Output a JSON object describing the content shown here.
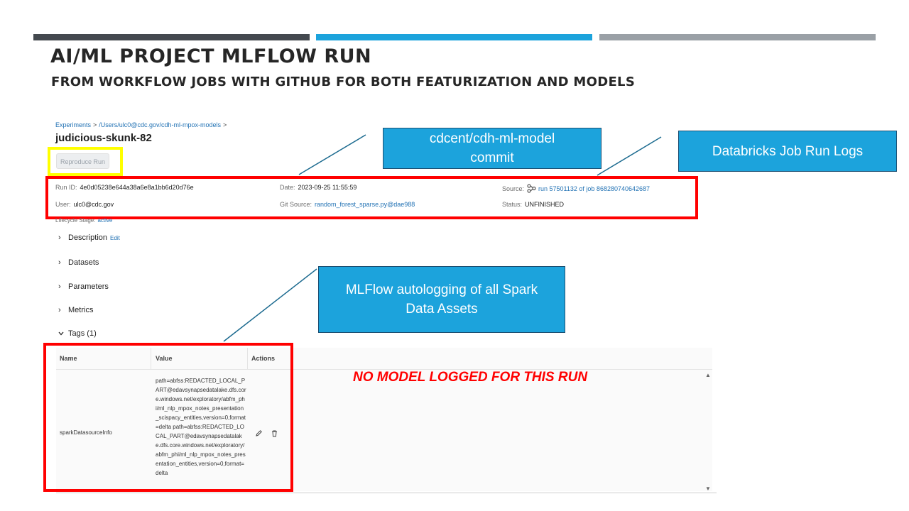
{
  "slide": {
    "title": "AI/ML PROJECT MLFLOW RUN",
    "subtitle": "FROM WORKFLOW JOBS WITH GITHUB FOR BOTH FEATURIZATION AND MODELS"
  },
  "breadcrumb": {
    "items": [
      "Experiments",
      "/Users/ulc0@cdc.gov/cdh-ml-mpox-models"
    ],
    "separator": ">"
  },
  "run": {
    "name": "judicious-skunk-82",
    "reproduce_label": "Reproduce Run"
  },
  "meta": {
    "run_id_label": "Run ID:",
    "run_id": "4e0d05238e644a38a6e8a1bb6d20d76e",
    "date_label": "Date:",
    "date": "2023-09-25 11:55:59",
    "source_label": "Source:",
    "source": "run 57501132 of job 868280740642687",
    "user_label": "User:",
    "user": "ulc0@cdc.gov",
    "git_label": "Git Source:",
    "git": "random_forest_sparse.py@dae988",
    "status_label": "Status:",
    "status": "UNFINISHED",
    "lifecycle_label": "Lifecycle Stage:",
    "lifecycle": "active"
  },
  "sections": {
    "description": "Description",
    "edit": "Edit",
    "datasets": "Datasets",
    "parameters": "Parameters",
    "metrics": "Metrics",
    "tags": "Tags (1)"
  },
  "tags_table": {
    "columns": [
      "Name",
      "Value",
      "Actions"
    ],
    "rows": [
      {
        "name": "sparkDatasourceInfo",
        "value": "path=abfss:REDACTED_LOCAL_PART@edavsynapsedatalake.dfs.core.windows.net/exploratory/abfm_phi/ml_nlp_mpox_notes_presentation_scispacy_entities,version=0,format=delta path=abfss:REDACTED_LOCAL_PART@edavsynapsedatalake.dfs.core.windows.net/exploratory/abfm_phi/ml_nlp_mpox_notes_presentation_entities,version=0,format=delta"
      }
    ]
  },
  "annotations": {
    "no_model": "NO MODEL LOGGED FOR THIS RUN",
    "callout_commit": [
      "cdcent/cdh-ml-model",
      "commit"
    ],
    "callout_logs": "Databricks Job Run Logs",
    "callout_autolog": [
      "MLFlow autologging of all Spark",
      "Data Assets"
    ]
  },
  "colors": {
    "accent_blue": "#1ca3dc",
    "link_blue": "#2272b4",
    "highlight_red": "#ff0000",
    "highlight_yellow": "#ffff00",
    "bar_dark": "#44494f",
    "bar_gray": "#9aa0a6"
  },
  "icons": {
    "source": "job-workflow-icon",
    "edit": "pencil-icon",
    "delete": "trash-icon",
    "expand": "chevron-right-icon",
    "collapse": "chevron-down-icon"
  }
}
